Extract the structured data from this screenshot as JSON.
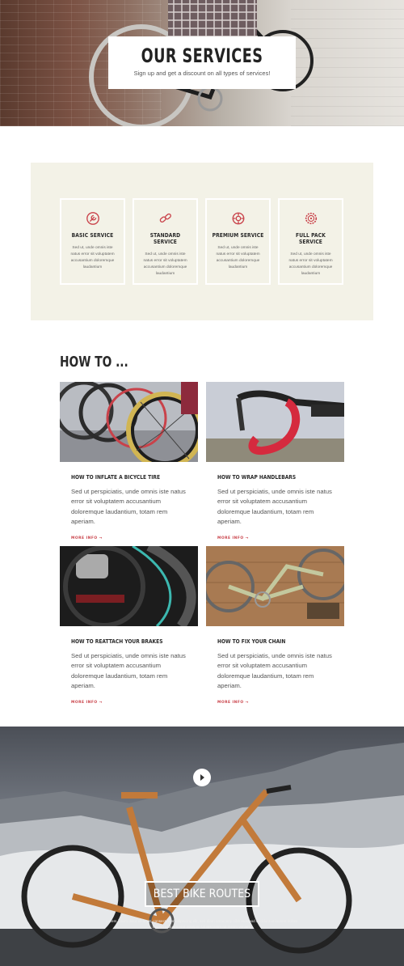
{
  "hero": {
    "title": "OUR SERVICES",
    "subtitle": "Sign up and get a discount on all types of services!"
  },
  "services": [
    {
      "name": "BASIC SERVICE",
      "icon": "wrench-circle-icon",
      "desc": "Sed ut, unde omnis iste natus error sit voluptatem accusantium doloremque laudantium"
    },
    {
      "name": "STANDARD SERVICE",
      "icon": "chain-link-icon",
      "desc": "Sed ut, unde omnis iste natus error sit voluptatem accusantium doloremque laudantium"
    },
    {
      "name": "PREMIUM SERVICE",
      "icon": "gear-wrench-icon",
      "desc": "Sed ut, unde omnis iste natus error sit voluptatem accusantium doloremque laudantium"
    },
    {
      "name": "FULL PACK SERVICE",
      "icon": "sprocket-icon",
      "desc": "Sed ut, unde omnis iste natus error sit voluptatem accusantium doloremque laudantium"
    }
  ],
  "howto": {
    "title": "HOW TO ...",
    "cards": [
      {
        "title": "HOW TO INFLATE A BICYCLE TIRE",
        "text": "Sed ut perspiciatis, unde omnis iste natus error sit voluptatem accusantium doloremque laudantium, totam rem aperiam.",
        "more": "MORE INFO →"
      },
      {
        "title": "HOW TO WRAP HANDLEBARS",
        "text": "Sed ut perspiciatis, unde omnis iste natus error sit voluptatem accusantium doloremque laudantium, totam rem aperiam.",
        "more": "MORE INFO →"
      },
      {
        "title": "HOW TO REATTACH YOUR BRAKES",
        "text": "Sed ut perspiciatis, unde omnis iste natus error sit voluptatem accusantium doloremque laudantium, totam rem aperiam.",
        "more": "MORE INFO →"
      },
      {
        "title": "HOW TO FIX YOUR CHAIN",
        "text": "Sed ut perspiciatis, unde omnis iste natus error sit voluptatem accusantium doloremque laudantium, totam rem aperiam.",
        "more": "MORE INFO →"
      }
    ]
  },
  "routes": {
    "button": "BEST BIKE ROUTES",
    "text": "Lorem ipsum dolor sit amet, consectetuer adipiscing elit, sed diam nonummy nibh euismod tincidunt ut laoreet dolore magna aliquam erat volutpat. Ut wisi enim ad minim veniam."
  },
  "colors": {
    "accent": "#c9424a",
    "panel": "#f3f2e7"
  }
}
